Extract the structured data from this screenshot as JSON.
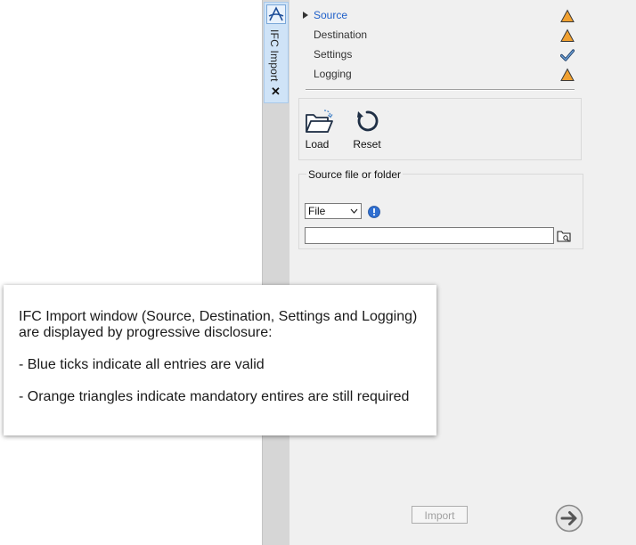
{
  "tab": {
    "label": "IFC Import",
    "close": "✕"
  },
  "steps": [
    {
      "label": "Source",
      "status": "warning-triangle-icon",
      "active": true
    },
    {
      "label": "Destination",
      "status": "warning-triangle-icon",
      "active": false
    },
    {
      "label": "Settings",
      "status": "check-icon",
      "active": false
    },
    {
      "label": "Logging",
      "status": "warning-triangle-icon",
      "active": false
    }
  ],
  "toolbar": {
    "load_label": "Load",
    "reset_label": "Reset"
  },
  "source_group": {
    "title": "Source file or folder",
    "type_value": "File",
    "path_value": ""
  },
  "footer": {
    "import_label": "Import"
  },
  "callout": {
    "line1": "IFC Import window (Source, Destination, Settings and Logging)",
    "line2": "are displayed by progressive disclosure:",
    "line3": "- Blue ticks indicate all entries are valid",
    "line4": "- Orange triangles indicate mandatory entires are still required"
  },
  "colors": {
    "active_step": "#1e5fc9",
    "warning": "#f0a030",
    "check": "#2e5f99",
    "info": "#2f6fd0"
  }
}
